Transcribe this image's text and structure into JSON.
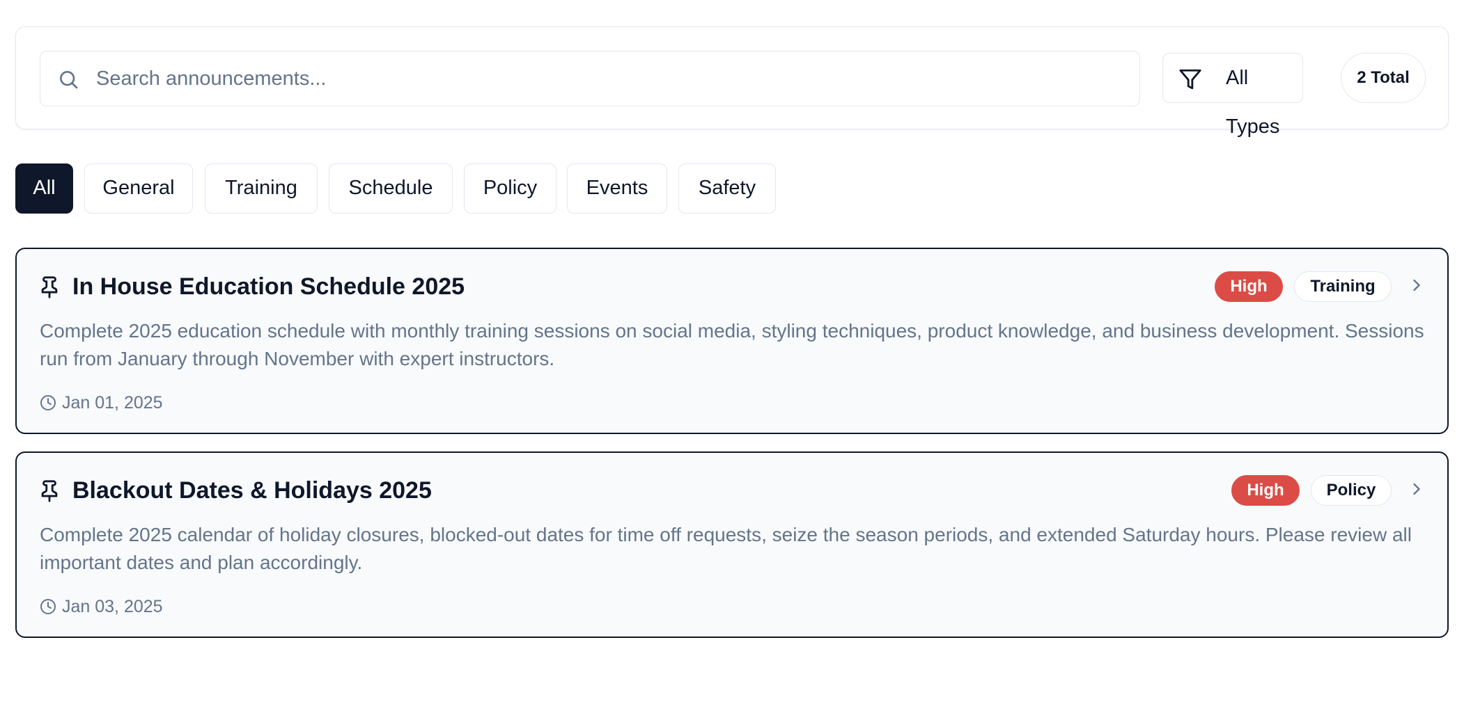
{
  "search": {
    "placeholder": "Search announcements...",
    "value": ""
  },
  "filter": {
    "label": "All Types",
    "icon": "filter-icon"
  },
  "total_badge": "2 Total",
  "category_tabs": [
    {
      "label": "All",
      "active": true
    },
    {
      "label": "General",
      "active": false
    },
    {
      "label": "Training",
      "active": false
    },
    {
      "label": "Schedule",
      "active": false
    },
    {
      "label": "Policy",
      "active": false
    },
    {
      "label": "Events",
      "active": false
    },
    {
      "label": "Safety",
      "active": false
    }
  ],
  "announcements": [
    {
      "title": "In House Education Schedule 2025",
      "description": "Complete 2025 education schedule with monthly training sessions on social media, styling techniques, product knowledge, and business development. Sessions run from January through November with expert instructors.",
      "date": "Jan 01, 2025",
      "priority": "High",
      "category": "Training",
      "pinned": true
    },
    {
      "title": "Blackout Dates & Holidays 2025",
      "description": "Complete 2025 calendar of holiday closures, blocked-out dates for time off requests, seize the season periods, and extended Saturday hours. Please review all important dates and plan accordingly.",
      "date": "Jan 03, 2025",
      "priority": "High",
      "category": "Policy",
      "pinned": true
    }
  ],
  "colors": {
    "active_tab": "#0f172a",
    "priority_high": "#dc4c46",
    "muted_text": "#64748b",
    "border": "#e2e8f0"
  }
}
